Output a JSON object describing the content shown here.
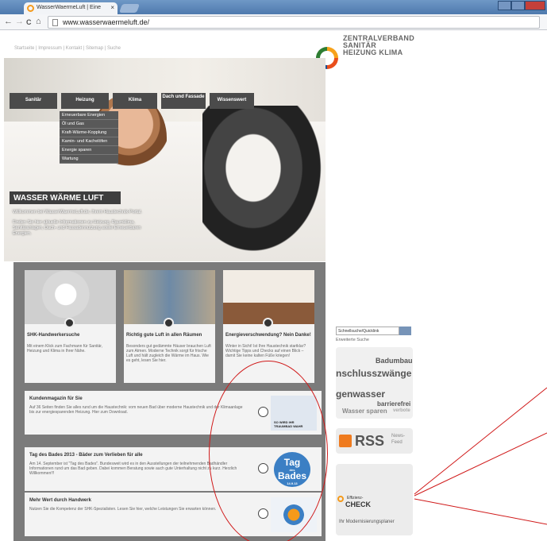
{
  "browser": {
    "tab_title": "WasserWaermeLuft | Eine",
    "tab_close": "×",
    "back": "←",
    "forward": "→",
    "reload": "C",
    "home": "⌂",
    "url": "www.wasserwaermeluft.de/"
  },
  "header": {
    "toplinks": "Startseite | Impressum | Kontakt | Sitemap | Suche",
    "logo_line1": "ZENTRALVERBAND",
    "logo_line2": "SANITÄR",
    "logo_line3": "HEIZUNG KLIMA"
  },
  "menu": [
    {
      "label": "Sanitär"
    },
    {
      "label": "Heizung"
    },
    {
      "label": "Klima"
    },
    {
      "label": "Dach und Fassade"
    },
    {
      "label": "Wissenswert"
    }
  ],
  "submenu": [
    {
      "label": "Erneuerbare Energien"
    },
    {
      "label": "Öl und Gas"
    },
    {
      "label": "Kraft-Wärme-Kopplung"
    },
    {
      "label": "Kamin- und Kachelöfen"
    },
    {
      "label": "Energie sparen"
    },
    {
      "label": "Wartung"
    }
  ],
  "hero": {
    "title": "WASSER WÄRME LUFT",
    "intro": "Willkommen bei WasserWaermeLuft.de, Ihrem Haustechnik-Portal.",
    "text": "Finden Sie hier aktuelle Informationen zu Heizung, Raumklima, Sanitäranlagen, Dach- und Fassadennutzung sowie Erneuerbaren Energien."
  },
  "cards": [
    {
      "title": "SHK-Handwerkersuche",
      "body": "Mit einem Klick zum Fachmann für Sanitär, Heizung und Klima in Ihrer Nähe."
    },
    {
      "title": "Richtig gute Luft in allen Räumen",
      "body": "Besonders gut gedämmte Häuser brauchen Luft zum Atmen. Moderne Technik sorgt für frische Luft und hält zugleich die Wärme im Haus. Wie es geht, lesen Sie hier."
    },
    {
      "title": "Energieverschwendung? Nein Danke!",
      "body": "Winter in Sicht! Ist Ihre Haustechnik startklar? Wichtige Tipps und Checks auf einen Blick – damit Sie keine kalten Füße kriegen!"
    }
  ],
  "banners": [
    {
      "title": "Kundenmagazin für Sie",
      "body": "Auf 36 Seiten finden Sie alles rund um die Haustechnik: vom neuen Bad über moderne Haustechnik und der Klimaanlage bis zur energiesparenden Heizung. Hier zum Download.",
      "img": "SO WIRD IHR TRAUMBAD WAHR"
    },
    {
      "title": "Tag des Bades 2013 - Bäder zum Verlieben für alle",
      "body": "Am 14. September ist \"Tag des Bades\". Bundesweit wird es in den Ausstellungen der teilnehmenden Badhändler Informationen rund um das Bad geben. Dabei kommen Beratung sowie auch gute Unterhaltung nicht zu kurz. Herzlich Willkommen!!!",
      "badge1": "Tag",
      "badge2": "des",
      "badge3": "Bades",
      "badge_date": "14.9.13"
    },
    {
      "title": "Mehr Wert durch Handwerk",
      "body": "Nutzen Sie die Kompetenz der SHK-Spezialisten. Lesen Sie hier, welche Leistungen Sie erwarten können."
    }
  ],
  "sidebar": {
    "search_placeholder": "Schnellsuche/Quicklink",
    "advanced": "Erweiterte Suche",
    "cloud": [
      "Badumbau",
      "nschlusszwänge",
      "genwasser",
      "barrierefrei",
      "Wasser sparen",
      "verbote"
    ],
    "rss": "RSS",
    "rss_sub1": "News-",
    "rss_sub2": "Feed",
    "check_label1": "Effizienz-",
    "check_label2": "CHECK",
    "check_planner": "Ihr Modernisierungsplaner"
  },
  "colors": {
    "annotation": "#d01a1a",
    "menu": "#4b4b4b",
    "content_bg": "#7b7b7b"
  }
}
